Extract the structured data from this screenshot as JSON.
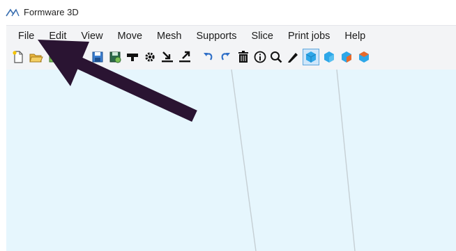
{
  "app": {
    "title": "Formware 3D",
    "logo_icon": "formware-logo-icon"
  },
  "menu": [
    {
      "label": "File"
    },
    {
      "label": "Edit"
    },
    {
      "label": "View"
    },
    {
      "label": "Move"
    },
    {
      "label": "Mesh"
    },
    {
      "label": "Supports"
    },
    {
      "label": "Slice"
    },
    {
      "label": "Print jobs"
    },
    {
      "label": "Help"
    }
  ],
  "toolbar": [
    {
      "icon": "new-file-icon"
    },
    {
      "icon": "open-folder-icon"
    },
    {
      "icon": "import-mesh-icon"
    },
    {
      "icon": "save-icon"
    },
    {
      "icon": "save-as-icon"
    },
    {
      "icon": "printer-platform-icon"
    },
    {
      "icon": "settings-gear-icon"
    },
    {
      "icon": "import-download-icon"
    },
    {
      "icon": "export-upload-icon"
    },
    {
      "icon": "undo-icon"
    },
    {
      "icon": "redo-icon"
    },
    {
      "icon": "delete-trash-icon"
    },
    {
      "icon": "info-icon"
    },
    {
      "icon": "search-zoom-icon"
    },
    {
      "icon": "pencil-edit-icon"
    },
    {
      "icon": "view-cube-front-icon",
      "selected": true
    },
    {
      "icon": "view-cube-side-icon"
    },
    {
      "icon": "view-cube-orange-icon"
    },
    {
      "icon": "view-cube-top-icon"
    }
  ],
  "colors": {
    "viewport_bg": "#e6f6fd",
    "toolbar_bg": "#f3f4f6",
    "annotation_arrow": "#2a1432",
    "cube_blue": "#2ea7e8",
    "cube_orange": "#e8692a"
  }
}
